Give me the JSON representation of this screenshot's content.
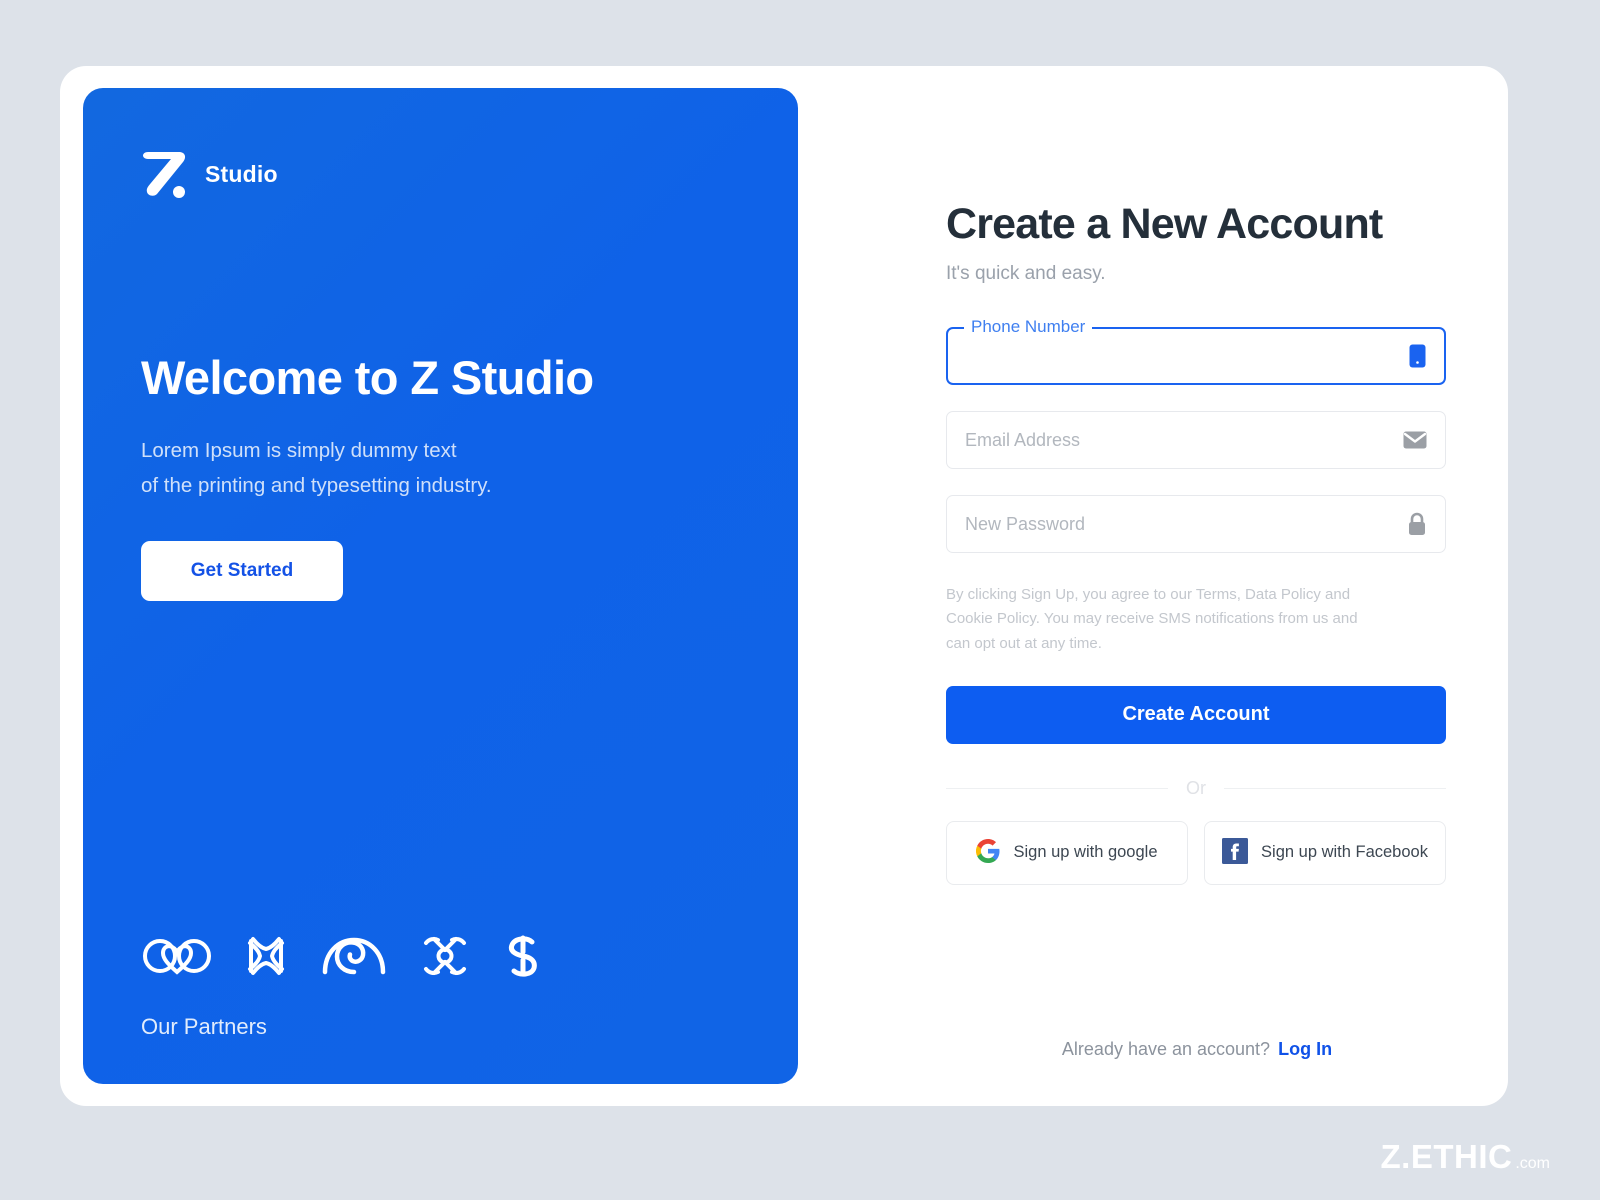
{
  "page": {
    "background_color": "#dde2e9",
    "accent_color": "#0d5df1"
  },
  "promo": {
    "brand_name": "Studio",
    "brand_mark_icon": "z-studio-logo-icon",
    "title": "Welcome to Z Studio",
    "subtitle_line1": "Lorem Ipsum is simply dummy text",
    "subtitle_line2": "of the printing and typesetting industry.",
    "cta_label": "Get Started",
    "partners_label": "Our Partners",
    "partner_logos": [
      {
        "icon": "partner-hearts-logo-icon"
      },
      {
        "icon": "partner-star-frame-logo-icon"
      },
      {
        "icon": "partner-spiral-arch-logo-icon"
      },
      {
        "icon": "partner-drone-cross-logo-icon"
      },
      {
        "icon": "partner-s-knot-logo-icon"
      }
    ]
  },
  "form": {
    "title": "Create a New Account",
    "subtitle": "It's quick and easy.",
    "phone": {
      "label": "Phone Number",
      "value": "",
      "placeholder": "",
      "icon": "phone-icon",
      "focused": true,
      "focus_color": "#1a63f0"
    },
    "email": {
      "value": "",
      "placeholder": "Email Address",
      "icon": "envelope-icon"
    },
    "password": {
      "value": "",
      "placeholder": "New Password",
      "icon": "lock-icon"
    },
    "terms_text": "By clicking Sign Up, you agree to our Terms, Data Policy and Cookie Policy. You may receive SMS notifications from us and can opt out at any time.",
    "submit_label": "Create Account",
    "divider_label": "Or",
    "social": [
      {
        "label": "Sign up with google",
        "icon": "google-icon"
      },
      {
        "label": "Sign up with Facebook",
        "icon": "facebook-icon"
      }
    ],
    "footer_text": "Already have an account?",
    "login_label": "Log In"
  },
  "watermark": {
    "main": "Z.ETHIC",
    "suffix": ".com"
  }
}
